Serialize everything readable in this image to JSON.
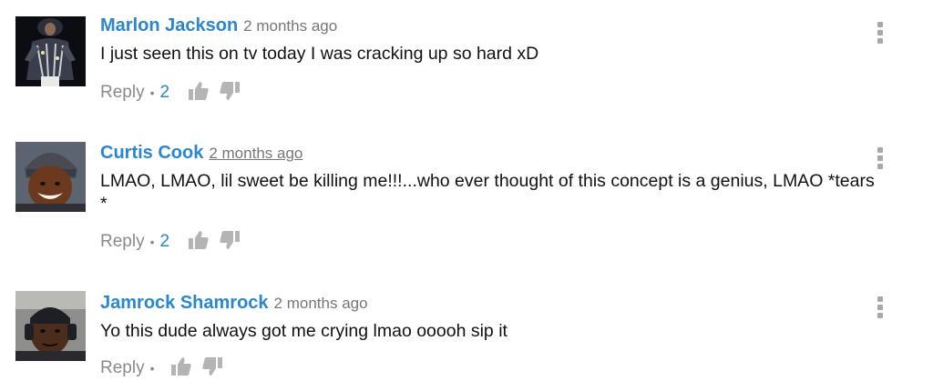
{
  "comments": [
    {
      "author": "Marlon Jackson",
      "time": "2 months ago",
      "text": "I just seen this on tv today I was cracking up so hard xD",
      "reply_label": "Reply",
      "separator": "•",
      "likes": "2",
      "avatar_icon": "performer-avatar"
    },
    {
      "author": "Curtis Cook",
      "time": "2 months ago",
      "text": "LMAO, LMAO, lil sweet be killing me!!!...who ever thought of this concept is a genius, LMAO *tears *",
      "reply_label": "Reply",
      "separator": "•",
      "likes": "2",
      "avatar_icon": "smiling-man-avatar"
    },
    {
      "author": "Jamrock Shamrock",
      "time": "2 months ago",
      "text": "Yo this dude always got me crying lmao ooooh sip it",
      "reply_label": "Reply",
      "separator": "•",
      "likes": "",
      "avatar_icon": "headphones-man-avatar"
    }
  ],
  "colors": {
    "author": "#2a86d0",
    "timestamp": "#767676",
    "muted": "#8a8a8a",
    "icon": "#b4b4b4"
  }
}
